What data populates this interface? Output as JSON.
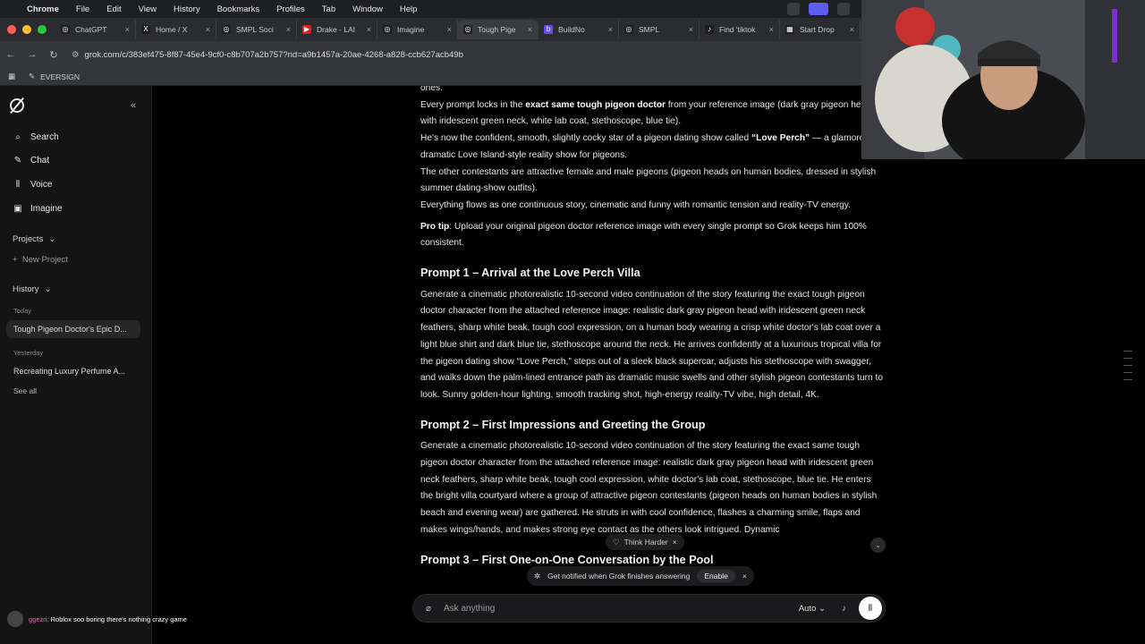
{
  "menubar": {
    "items": [
      "Chrome",
      "File",
      "Edit",
      "View",
      "History",
      "Bookmarks",
      "Profiles",
      "Tab",
      "Window",
      "Help"
    ]
  },
  "tabs": [
    {
      "label": "ChatGPT",
      "color": "#1f1f1f",
      "glyph": "◎"
    },
    {
      "label": "Home / X",
      "color": "#1f1f1f",
      "glyph": "X"
    },
    {
      "label": "SMPL Soci",
      "color": "#1f1f1f",
      "glyph": "◎"
    },
    {
      "label": "Drake - LAI",
      "color": "#e01e1e",
      "glyph": "▶"
    },
    {
      "label": "Imagine",
      "color": "#1f1f1f",
      "glyph": "◎"
    },
    {
      "label": "Tough Pige",
      "color": "#1f1f1f",
      "glyph": "◎"
    },
    {
      "label": "BuildNo",
      "color": "#6b4cf0",
      "glyph": "b"
    },
    {
      "label": "SMPL",
      "color": "#1f1f1f",
      "glyph": "◎"
    },
    {
      "label": "Find 'tiktok",
      "color": "#1f1f1f",
      "glyph": "♪"
    },
    {
      "label": "Start Drop",
      "color": "#1f1f1f",
      "glyph": "▦"
    }
  ],
  "address": {
    "url": "grok.com/c/383ef475-8f87-45e4-9cf0-c8b707a2b757?rid=a9b1457a-20ae-4268-a828-ccb627acb49b"
  },
  "bookmarks": {
    "item": "EVERSIGN"
  },
  "sidebar": {
    "nav": [
      "Search",
      "Chat",
      "Voice",
      "Imagine"
    ],
    "projects_label": "Projects",
    "new_project": "New Project",
    "history_label": "History",
    "today": "Today",
    "today_item": "Tough Pigeon Doctor's Epic D...",
    "yesterday": "Yesterday",
    "yesterday_item": "Recreating Luxury Perfume A...",
    "see_all": "See all"
  },
  "content": {
    "frag": "ones.",
    "p1_a": "Every prompt locks in the ",
    "p1_b": "exact same tough pigeon doctor",
    "p1_c": " from your reference image (dark gray pigeon head with iridescent green neck, white lab coat, stethoscope, blue tie).",
    "p2_a": "He's now the confident, smooth, slightly cocky star of a pigeon dating show called ",
    "p2_b": "“Love Perch”",
    "p2_c": " — a glamorous, dramatic Love Island-style reality show for pigeons.",
    "p3": "The other contestants are attractive female and male pigeons (pigeon heads on human bodies, dressed in stylish summer dating-show outfits).",
    "p4": "Everything flows as one continuous story, cinematic and funny with romantic tension and reality-TV energy.",
    "tip_label": "Pro tip",
    "tip_text": ": Upload your original pigeon doctor reference image with every single prompt so Grok keeps him 100% consistent.",
    "h1": "Prompt 1 – Arrival at the Love Perch Villa",
    "body1": "Generate a cinematic photorealistic 10-second video continuation of the story featuring the exact tough pigeon doctor character from the attached reference image: realistic dark gray pigeon head with iridescent green neck feathers, sharp white beak, tough cool expression, on a human body wearing a crisp white doctor's lab coat over a light blue shirt and dark blue tie, stethoscope around the neck. He arrives confidently at a luxurious tropical villa for the pigeon dating show “Love Perch,” steps out of a sleek black supercar, adjusts his stethoscope with swagger, and walks down the palm-lined entrance path as dramatic music swells and other stylish pigeon contestants turn to look. Sunny golden-hour lighting, smooth tracking shot, high-energy reality-TV vibe, high detail, 4K.",
    "h2": "Prompt 2 – First Impressions and Greeting the Group",
    "body2": "Generate a cinematic photorealistic 10-second video continuation of the story featuring the exact same tough pigeon doctor character from the attached reference image: realistic dark gray pigeon head with iridescent green neck feathers, sharp white beak, tough cool expression, white doctor's lab coat, stethoscope, blue tie. He enters the bright villa courtyard where a group of attractive pigeon contestants (pigeon heads on human bodies in stylish beach and evening wear) are gathered. He struts in with cool confidence, flashes a charming smile, flaps and makes wings/hands, and makes strong eye contact as the others look intrigued. Dynamic",
    "h3": "Prompt 3 – First One-on-One Conversation by the Pool"
  },
  "ui": {
    "think_harder": "Think Harder",
    "notify_text": "Get notified when Grok finishes answering",
    "enable": "Enable",
    "ask_placeholder": "Ask anything",
    "mode": "Auto"
  },
  "stream_chat": {
    "user": "ggezri:",
    "message": "Roblox soo boring there's nothing crazy game"
  }
}
